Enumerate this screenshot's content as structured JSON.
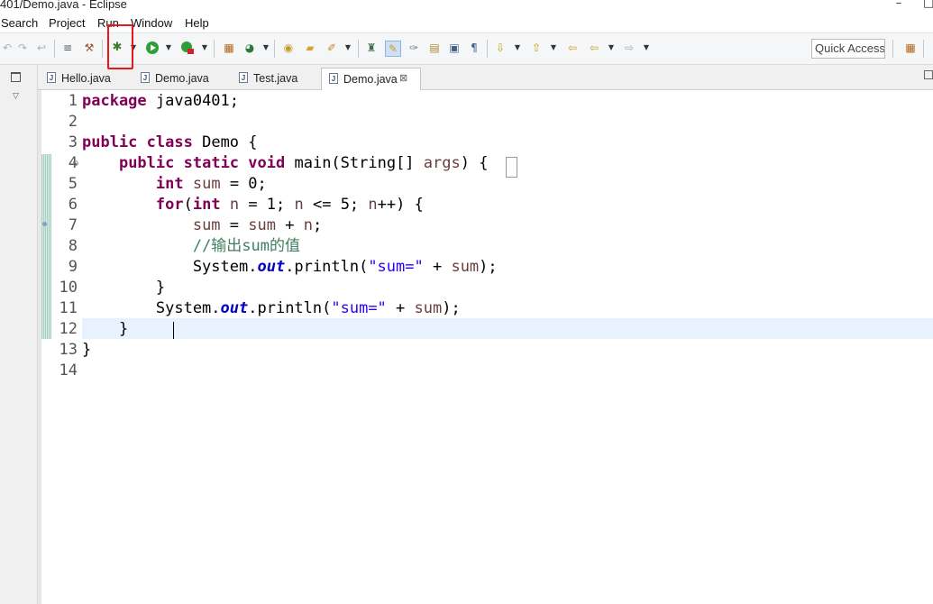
{
  "window": {
    "title": "401/Demo.java - Eclipse",
    "minimize": "–",
    "right_glyph": "□"
  },
  "menu": [
    "Search",
    "Project",
    "Run",
    "Window",
    "Help"
  ],
  "toolbar": {
    "quick_access": "Quick Access",
    "highlight_color": "#e8171b"
  },
  "tabs": [
    {
      "label": "Hello.java",
      "active": false
    },
    {
      "label": "Demo.java",
      "active": false
    },
    {
      "label": "Test.java",
      "active": false
    },
    {
      "label": "Demo.java",
      "active": true
    }
  ],
  "tab_close": "⊠",
  "editor": {
    "line_numbers": [
      "1",
      "2",
      "3",
      "4",
      "5",
      "6",
      "7",
      "8",
      "9",
      "10",
      "11",
      "12",
      "13",
      "14"
    ],
    "current_line": 12,
    "lines": [
      [
        {
          "c": "kw",
          "t": "package"
        },
        {
          "c": "",
          "t": " java0401;"
        }
      ],
      [],
      [
        {
          "c": "kw",
          "t": "public"
        },
        {
          "c": "",
          "t": " "
        },
        {
          "c": "kw",
          "t": "class"
        },
        {
          "c": "",
          "t": " Demo {"
        }
      ],
      [
        {
          "c": "",
          "t": "    "
        },
        {
          "c": "kw",
          "t": "public"
        },
        {
          "c": "",
          "t": " "
        },
        {
          "c": "kw",
          "t": "static"
        },
        {
          "c": "",
          "t": " "
        },
        {
          "c": "kw",
          "t": "void"
        },
        {
          "c": "",
          "t": " main(String[] "
        },
        {
          "c": "var",
          "t": "args"
        },
        {
          "c": "",
          "t": ") {"
        }
      ],
      [
        {
          "c": "",
          "t": "        "
        },
        {
          "c": "kw",
          "t": "int"
        },
        {
          "c": "",
          "t": " "
        },
        {
          "c": "var",
          "t": "sum"
        },
        {
          "c": "",
          "t": " = 0;"
        }
      ],
      [
        {
          "c": "",
          "t": "        "
        },
        {
          "c": "kw",
          "t": "for"
        },
        {
          "c": "",
          "t": "("
        },
        {
          "c": "kw",
          "t": "int"
        },
        {
          "c": "",
          "t": " "
        },
        {
          "c": "var",
          "t": "n"
        },
        {
          "c": "",
          "t": " = 1; "
        },
        {
          "c": "var",
          "t": "n"
        },
        {
          "c": "",
          "t": " <= 5; "
        },
        {
          "c": "var",
          "t": "n"
        },
        {
          "c": "",
          "t": "++) {"
        }
      ],
      [
        {
          "c": "",
          "t": "            "
        },
        {
          "c": "var",
          "t": "sum"
        },
        {
          "c": "",
          "t": " = "
        },
        {
          "c": "var",
          "t": "sum"
        },
        {
          "c": "",
          "t": " + "
        },
        {
          "c": "var",
          "t": "n"
        },
        {
          "c": "",
          "t": ";"
        }
      ],
      [
        {
          "c": "",
          "t": "            "
        },
        {
          "c": "cmt",
          "t": "//输出sum的值"
        }
      ],
      [
        {
          "c": "",
          "t": "            System."
        },
        {
          "c": "fld",
          "t": "out"
        },
        {
          "c": "",
          "t": ".println("
        },
        {
          "c": "str",
          "t": "\"sum=\""
        },
        {
          "c": "",
          "t": " + "
        },
        {
          "c": "var",
          "t": "sum"
        },
        {
          "c": "",
          "t": ");"
        }
      ],
      [
        {
          "c": "",
          "t": "        }"
        }
      ],
      [
        {
          "c": "",
          "t": "        System."
        },
        {
          "c": "fld",
          "t": "out"
        },
        {
          "c": "",
          "t": ".println("
        },
        {
          "c": "str",
          "t": "\"sum=\""
        },
        {
          "c": "",
          "t": " + "
        },
        {
          "c": "var",
          "t": "sum"
        },
        {
          "c": "",
          "t": ");"
        }
      ],
      [
        {
          "c": "",
          "t": "    }"
        }
      ],
      [
        {
          "c": "",
          "t": "}"
        }
      ],
      []
    ]
  },
  "colors": {
    "keyword": "#7f0055",
    "string": "#2a00ff",
    "field": "#0000c0",
    "comment": "#3f7f5f",
    "current_line": "#e8f2fe"
  }
}
